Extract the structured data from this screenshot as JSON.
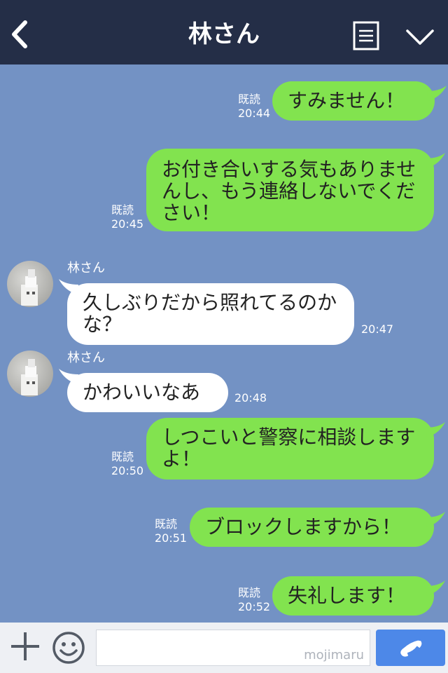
{
  "header": {
    "title": "林さん"
  },
  "messages": [
    {
      "side": "sent",
      "text": "すみません！",
      "read": "既読",
      "time": "20:44"
    },
    {
      "side": "sent",
      "text": "お付き合いする気もありませんし、もう連絡しないでください！",
      "read": "既読",
      "time": "20:45"
    },
    {
      "side": "received",
      "sender": "林さん",
      "text": "久しぶりだから照れてるのかな？",
      "time": "20:47"
    },
    {
      "side": "received",
      "sender": "林さん",
      "text": "かわいいなあ",
      "time": "20:48"
    },
    {
      "side": "sent",
      "text": "しつこいと警察に相談しますよ！",
      "read": "既読",
      "time": "20:50"
    },
    {
      "side": "sent",
      "text": "ブロックしますから！",
      "read": "既読",
      "time": "20:51"
    },
    {
      "side": "sent",
      "text": "失礼します！",
      "read": "既読",
      "time": "20:52"
    }
  ],
  "footer": {
    "input_value": "",
    "watermark": "mojimaru"
  },
  "colors": {
    "header_bg": "#242e47",
    "chat_bg": "#7392c4",
    "sent_bubble": "#82e34f",
    "received_bubble": "#ffffff",
    "send_button": "#4d88e8"
  },
  "icons": {
    "back": "chevron-left-icon",
    "menu": "note-icon",
    "collapse": "chevron-down-icon",
    "add": "plus-icon",
    "sticker": "smiley-icon",
    "send": "phone-icon"
  }
}
